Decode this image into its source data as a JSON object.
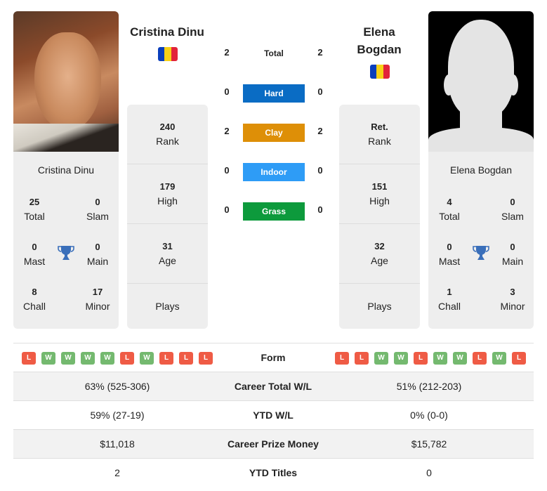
{
  "player1": {
    "name": "Cristina Dinu",
    "header_name_lines": [
      "Cristina Dinu"
    ],
    "flag_colors": [
      "#0a3fbc",
      "#f7d117",
      "#e2233a"
    ],
    "titles": {
      "total": {
        "value": "25",
        "label": "Total"
      },
      "slam": {
        "value": "0",
        "label": "Slam"
      },
      "mast": {
        "value": "0",
        "label": "Mast"
      },
      "main": {
        "value": "0",
        "label": "Main"
      },
      "chall": {
        "value": "8",
        "label": "Chall"
      },
      "minor": {
        "value": "17",
        "label": "Minor"
      }
    },
    "stats": {
      "rank": {
        "value": "240",
        "label": "Rank"
      },
      "high": {
        "value": "179",
        "label": "High"
      },
      "age": {
        "value": "31",
        "label": "Age"
      },
      "plays": {
        "value": "",
        "label": "Plays"
      }
    },
    "form": [
      "L",
      "W",
      "W",
      "W",
      "W",
      "L",
      "W",
      "L",
      "L",
      "L"
    ]
  },
  "player2": {
    "name": "Elena Bogdan",
    "header_name_lines": [
      "Elena",
      "Bogdan"
    ],
    "flag_colors": [
      "#0a3fbc",
      "#f7d117",
      "#e2233a"
    ],
    "titles": {
      "total": {
        "value": "4",
        "label": "Total"
      },
      "slam": {
        "value": "0",
        "label": "Slam"
      },
      "mast": {
        "value": "0",
        "label": "Mast"
      },
      "main": {
        "value": "0",
        "label": "Main"
      },
      "chall": {
        "value": "1",
        "label": "Chall"
      },
      "minor": {
        "value": "3",
        "label": "Minor"
      }
    },
    "stats": {
      "rank": {
        "value": "Ret.",
        "label": "Rank"
      },
      "high": {
        "value": "151",
        "label": "High"
      },
      "age": {
        "value": "32",
        "label": "Age"
      },
      "plays": {
        "value": "",
        "label": "Plays"
      }
    },
    "form": [
      "L",
      "L",
      "W",
      "W",
      "L",
      "W",
      "W",
      "L",
      "W",
      "L"
    ]
  },
  "h2h": {
    "total": {
      "label": "Total",
      "p1": "2",
      "p2": "2"
    },
    "surfaces": [
      {
        "label": "Hard",
        "p1": "0",
        "p2": "0",
        "color": "#0a6cc4"
      },
      {
        "label": "Clay",
        "p1": "2",
        "p2": "2",
        "color": "#de8f07"
      },
      {
        "label": "Indoor",
        "p1": "0",
        "p2": "0",
        "color": "#2e9cf6"
      },
      {
        "label": "Grass",
        "p1": "0",
        "p2": "0",
        "color": "#0d9a3c"
      }
    ]
  },
  "comparison": {
    "form_label": "Form",
    "rows": [
      {
        "label": "Career Total W/L",
        "p1": "63% (525-306)",
        "p2": "51% (212-203)"
      },
      {
        "label": "YTD W/L",
        "p1": "59% (27-19)",
        "p2": "0% (0-0)"
      },
      {
        "label": "Career Prize Money",
        "p1": "$11,018",
        "p2": "$15,782"
      },
      {
        "label": "YTD Titles",
        "p1": "2",
        "p2": "0"
      }
    ]
  },
  "icons": {
    "trophy": "trophy-icon",
    "trophy_color": "#3a6fba"
  }
}
